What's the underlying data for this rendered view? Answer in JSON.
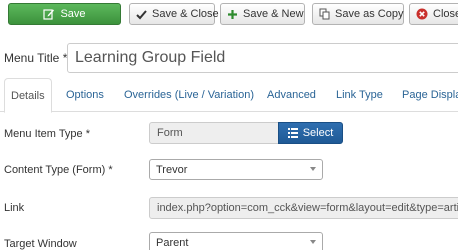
{
  "toolbar": {
    "save": "Save",
    "save_close": "Save & Close",
    "save_new": "Save & New",
    "save_copy": "Save as Copy",
    "close": "Close"
  },
  "title": {
    "label": "Menu Title *",
    "value": "Learning Group Field"
  },
  "tabs": [
    {
      "label": "Details",
      "active": true
    },
    {
      "label": "Options"
    },
    {
      "label": "Overrides (Live / Variation)"
    },
    {
      "label": "Advanced"
    },
    {
      "label": "Link Type"
    },
    {
      "label": "Page Display"
    }
  ],
  "form": {
    "menu_item_type": {
      "label": "Menu Item Type *",
      "value": "Form",
      "button": "Select"
    },
    "content_type": {
      "label": "Content Type (Form) *",
      "value": "Trevor"
    },
    "link": {
      "label": "Link",
      "value": "index.php?option=com_cck&view=form&layout=edit&type=article"
    },
    "target_window": {
      "label": "Target Window",
      "value": "Parent"
    }
  },
  "colors": {
    "save_green": "#5cb85c",
    "select_blue": "#2f6fb0",
    "close_red": "#c9302c",
    "link_blue": "#2a6496"
  }
}
